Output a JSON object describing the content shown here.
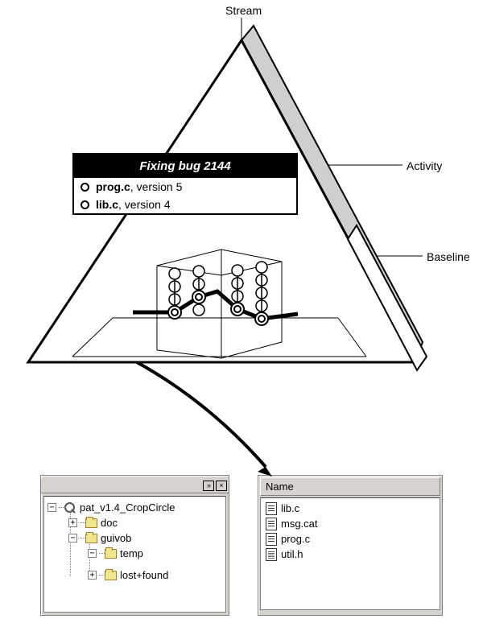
{
  "labels": {
    "stream": "Stream",
    "activity": "Activity",
    "baseline": "Baseline"
  },
  "activity_card": {
    "title": "Fixing bug 2144",
    "rows": [
      {
        "file": "prog.c",
        "suffix": ",  version 5"
      },
      {
        "file": "lib.c",
        "suffix": ", version 4"
      }
    ]
  },
  "tree": {
    "root": "pat_v1.4_CropCircle",
    "nodes": {
      "doc": "doc",
      "guivob": "guivob",
      "temp": "temp",
      "lostfound": "lost+found"
    }
  },
  "filelist": {
    "header": "Name",
    "files": [
      {
        "name": "lib.c",
        "icon": "script"
      },
      {
        "name": "msg.cat",
        "icon": "script"
      },
      {
        "name": "prog.c",
        "icon": "script"
      },
      {
        "name": "util.h",
        "icon": "lines"
      }
    ]
  },
  "icons": {
    "dropdown": "»",
    "close": "×",
    "plus": "+",
    "minus": "−"
  }
}
